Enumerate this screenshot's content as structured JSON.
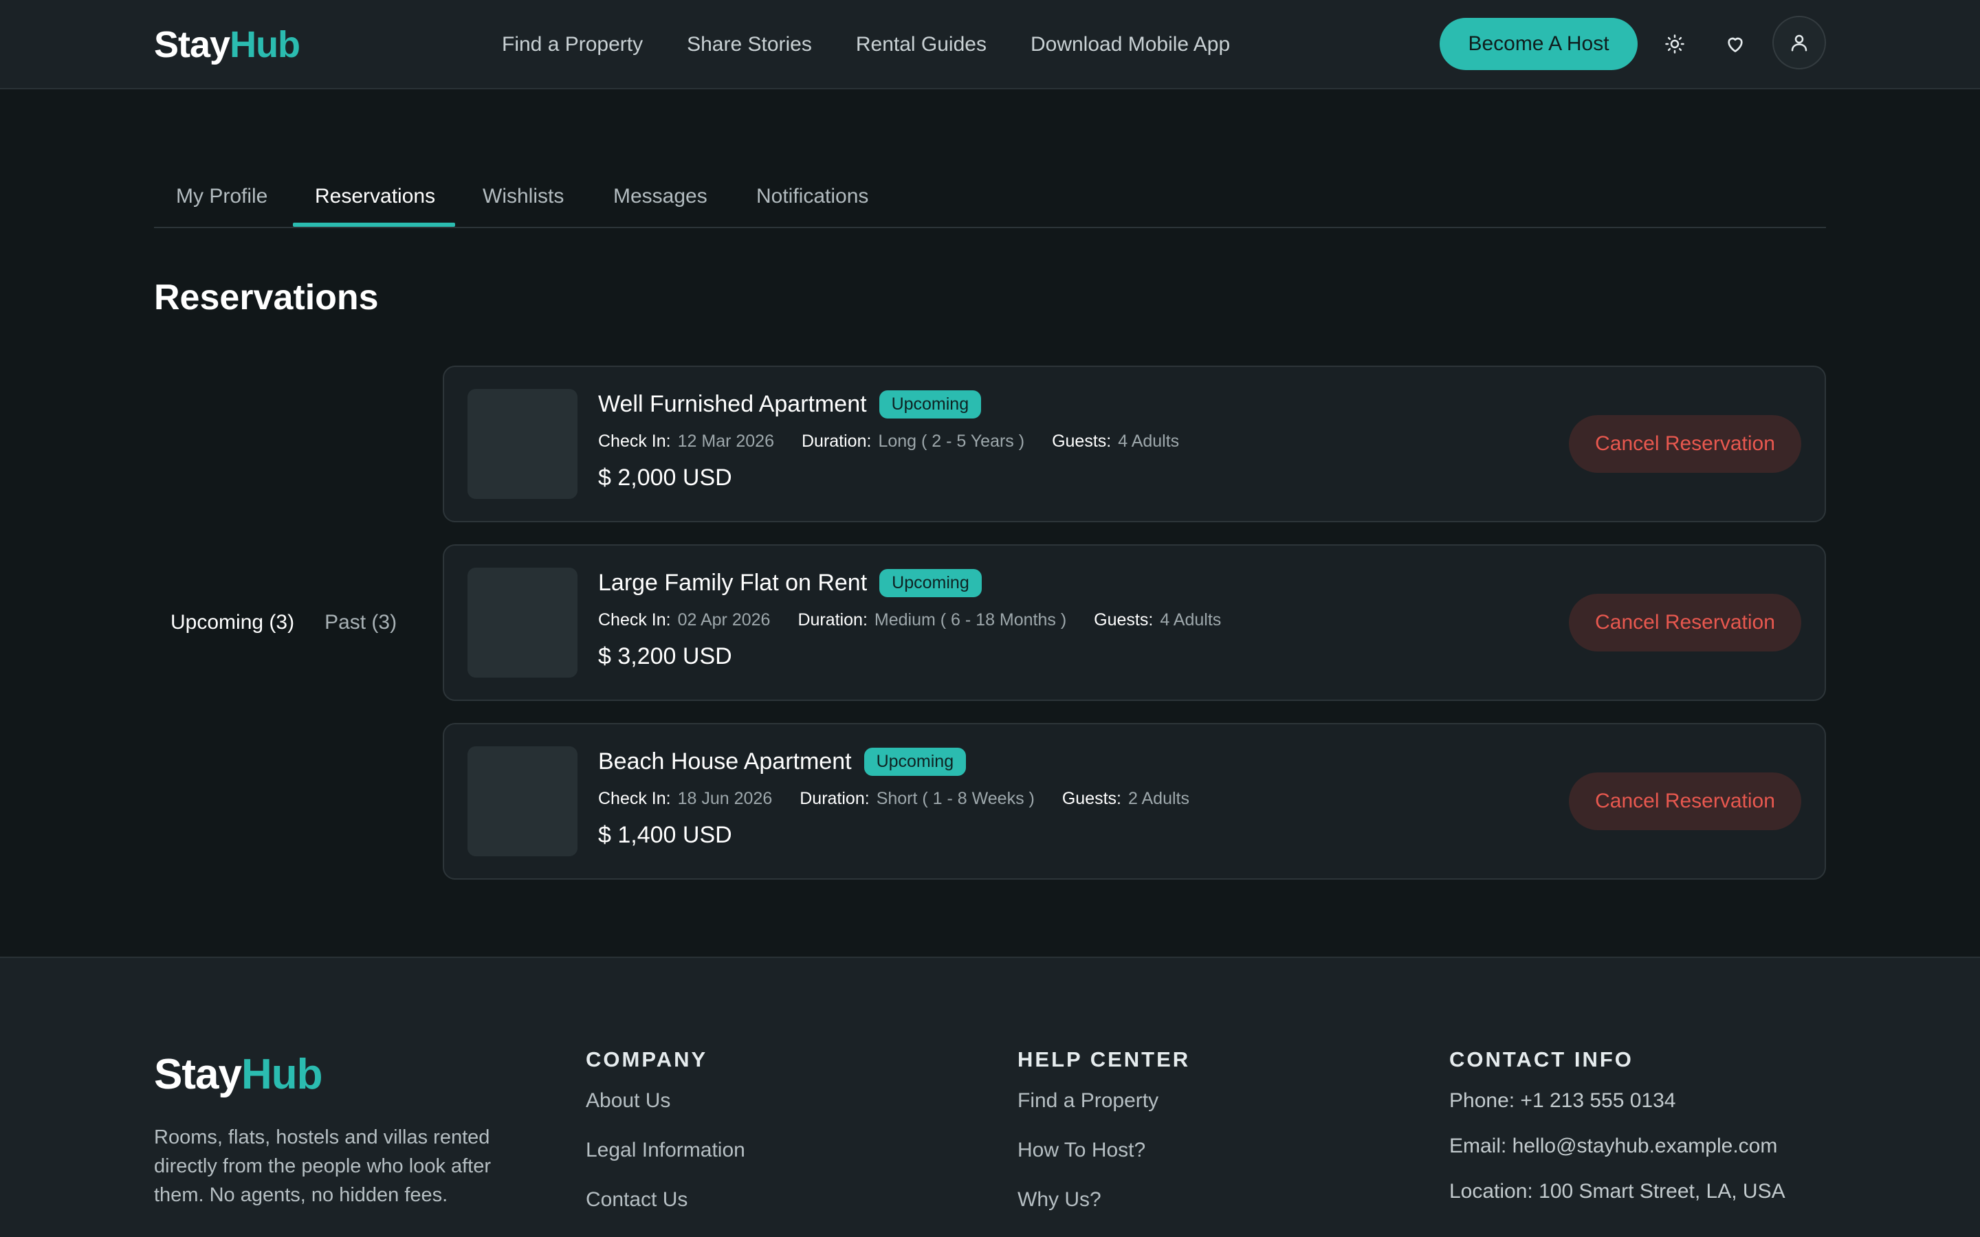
{
  "brand": {
    "part1": "Stay",
    "part2": "Hub"
  },
  "nav": {
    "items": [
      "Find a Property",
      "Share Stories",
      "Rental Guides",
      "Download Mobile App"
    ],
    "host_button": "Become A Host",
    "icons": [
      "sun-icon",
      "heart-icon",
      "user-icon"
    ]
  },
  "tabs": {
    "items": [
      "My Profile",
      "Reservations",
      "Wishlists",
      "Messages",
      "Notifications"
    ],
    "active": "Reservations"
  },
  "page_title": "Reservations",
  "filters": {
    "upcoming": "Upcoming (3)",
    "past": "Past (3)"
  },
  "labels": {
    "check_in": "Check In:",
    "duration": "Duration:",
    "guests": "Guests:",
    "cancel": "Cancel Reservation"
  },
  "reservations": [
    {
      "title": "Well Furnished Apartment",
      "status": "Upcoming",
      "check_in": "12 Mar 2026",
      "duration": "Long ( 2 - 5 Years )",
      "guests": "4 Adults",
      "price": "$ 2,000 USD"
    },
    {
      "title": "Large Family Flat on Rent",
      "status": "Upcoming",
      "check_in": "02 Apr 2026",
      "duration": "Medium ( 6 - 18 Months )",
      "guests": "4 Adults",
      "price": "$ 3,200 USD"
    },
    {
      "title": "Beach House Apartment",
      "status": "Upcoming",
      "check_in": "18 Jun 2026",
      "duration": "Short ( 1 - 8 Weeks )",
      "guests": "2 Adults",
      "price": "$ 1,400 USD"
    }
  ],
  "footer": {
    "description": "Rooms, flats, hostels and villas rented directly from the people who look after them. No agents, no hidden fees.",
    "company": {
      "heading": "COMPANY",
      "links": [
        "About Us",
        "Legal Information",
        "Contact Us"
      ]
    },
    "help": {
      "heading": "HELP CENTER",
      "links": [
        "Find a Property",
        "How To Host?",
        "Why Us?"
      ]
    },
    "contact": {
      "heading": "CONTACT INFO",
      "items": [
        "Phone: +1 213 555 0134",
        "Email: hello@stayhub.example.com",
        "Location: 100 Smart Street, LA, USA"
      ]
    }
  },
  "colors": {
    "accent": "#2bbcb0",
    "danger": "#e8584f",
    "background": "#111719",
    "surface": "#1b2226"
  }
}
